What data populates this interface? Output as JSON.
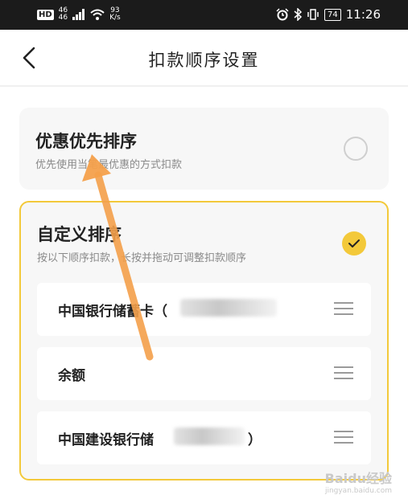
{
  "status_bar": {
    "hd": "HD",
    "network_top": "46",
    "network_bottom": "46",
    "speed_value": "93",
    "speed_unit": "K/s",
    "battery": "74",
    "time": "11:26"
  },
  "nav": {
    "title": "扣款顺序设置",
    "back_icon": "chevron-left-icon"
  },
  "options": [
    {
      "title": "优惠优先排序",
      "subtitle": "优先使用当笔最优惠的方式扣款",
      "selected": false
    },
    {
      "title": "自定义排序",
      "subtitle": "按以下顺序扣款，长按并拖动可调整扣款顺序",
      "selected": true
    }
  ],
  "payment_methods": [
    {
      "label": "中国银行储蓄卡（"
    },
    {
      "label": "余额"
    },
    {
      "label": "中国建设银行储",
      "suffix": "）"
    }
  ],
  "colors": {
    "accent": "#f3c93a",
    "annotation_arrow": "#f4a04b"
  },
  "watermark": {
    "main": "Baidu经验",
    "sub": "jingyan.baidu.com"
  }
}
